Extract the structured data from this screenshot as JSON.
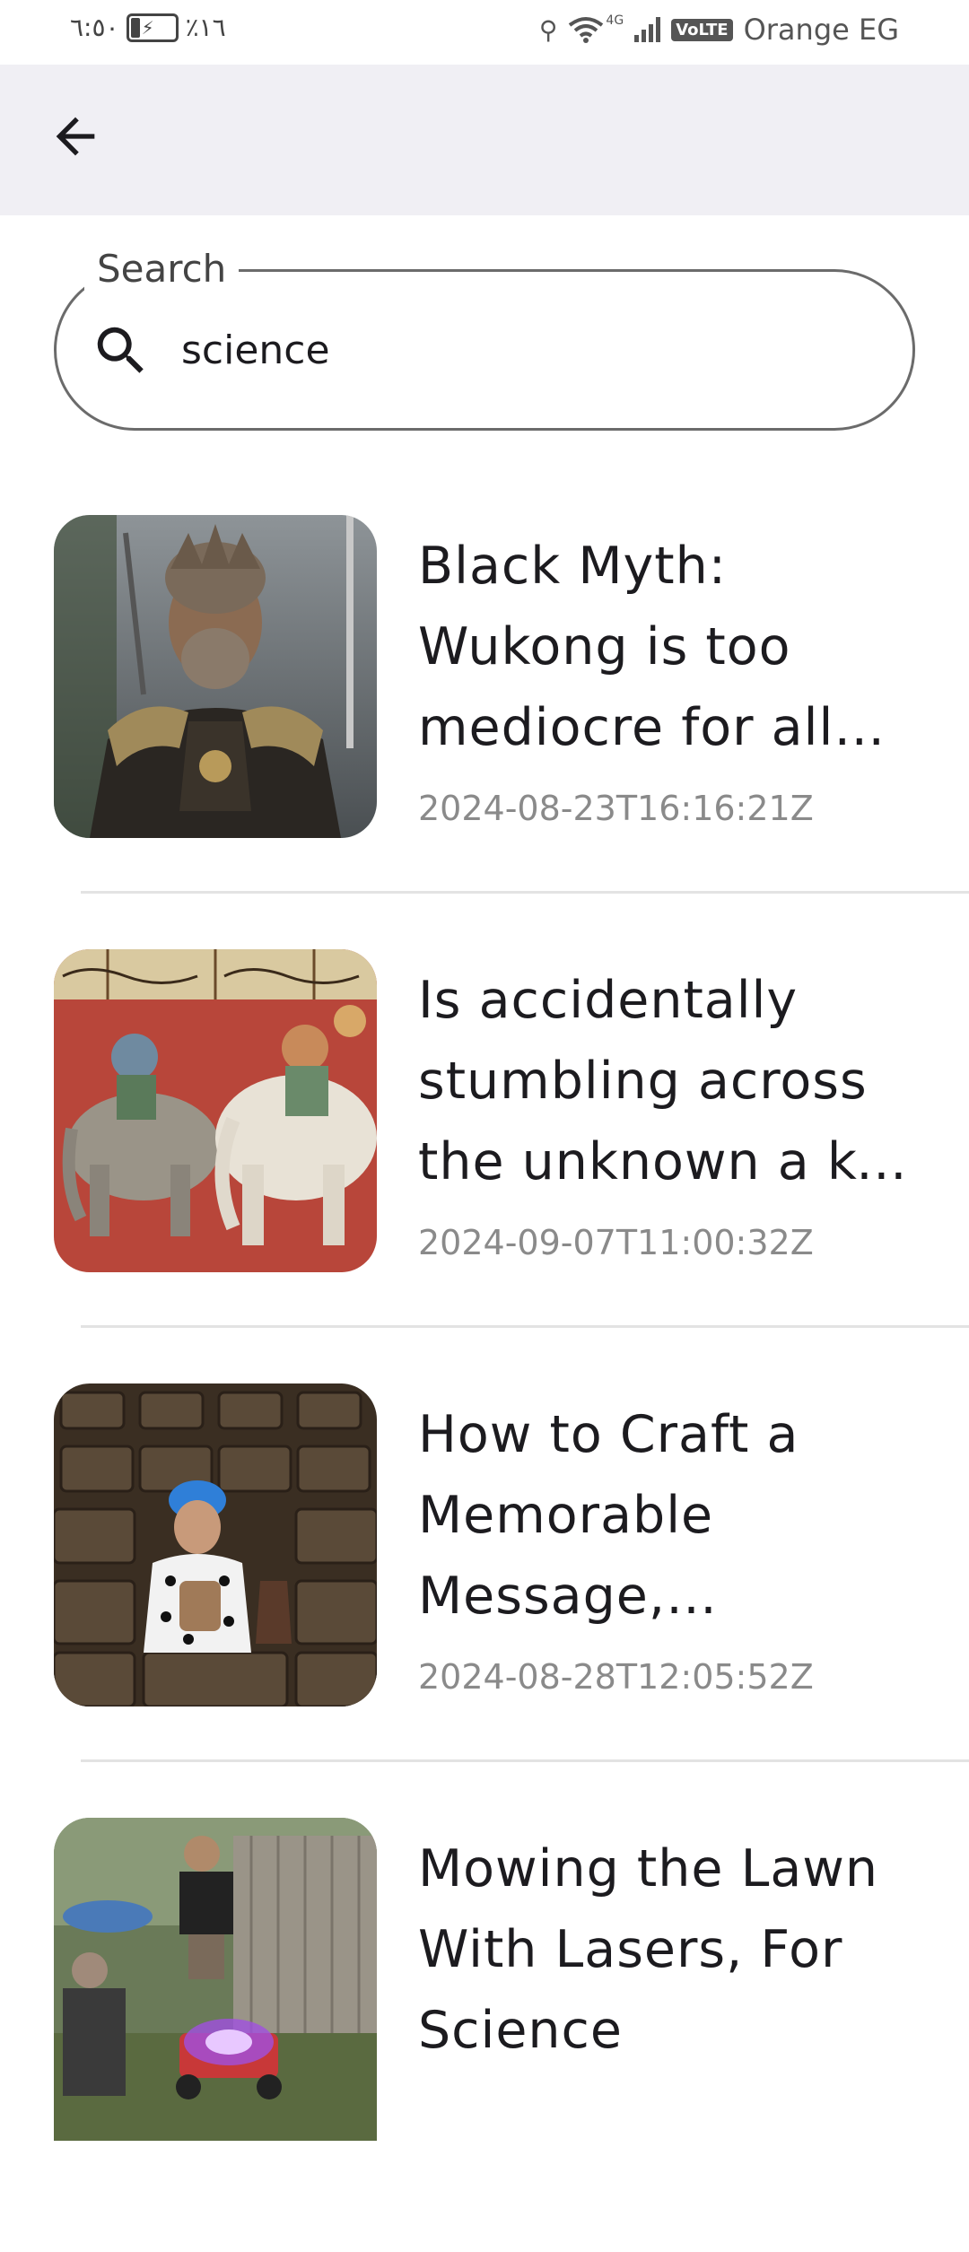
{
  "status_bar": {
    "time": "٦:٥٠",
    "battery": "٪١٦",
    "carrier": "Orange EG",
    "network": "4G",
    "volte": "VoLTE"
  },
  "app_bar": {
    "back_icon": "arrow-back-icon"
  },
  "search": {
    "label": "Search",
    "value": "science",
    "icon": "search-icon"
  },
  "results": [
    {
      "title": "Black Myth: Wukong is too mediocre for all the hype it got",
      "date": "2024-08-23T16:16:21Z"
    },
    {
      "title": "Is accidentally stumbling across the unknown a key to science",
      "date": "2024-09-07T11:00:32Z"
    },
    {
      "title": "How to Craft a Memorable Message, According to Science",
      "date": "2024-08-28T12:05:52Z"
    },
    {
      "title": "Mowing the Lawn With Lasers, For Science",
      "date": ""
    }
  ]
}
